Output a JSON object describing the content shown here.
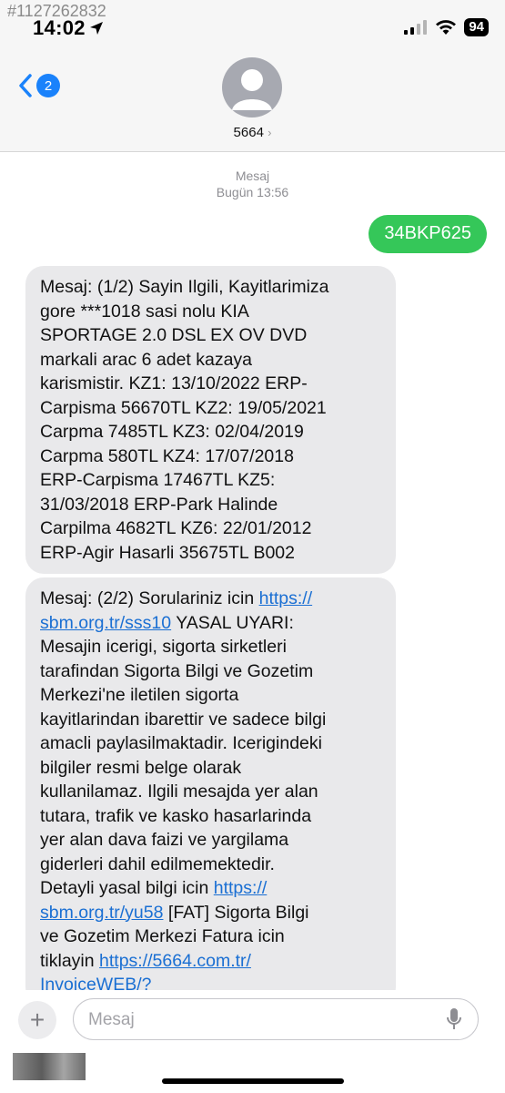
{
  "overlay_id": "#1127262832",
  "status_bar": {
    "time": "14:02",
    "battery": "94"
  },
  "header": {
    "back_badge": "2",
    "contact_name": "5664"
  },
  "thread": {
    "meta_label": "Mesaj",
    "meta_time": "Bugün 13:56",
    "outgoing": "34BKP625",
    "incoming": [
      {
        "lines": [
          "Mesaj: (1/2) Sayin Ilgili, Kayitlarimiza",
          "gore ***1018 sasi nolu KIA",
          "SPORTAGE 2.0 DSL EX OV DVD",
          "markali arac 6 adet kazaya",
          "karismistir. KZ1: 13/10/2022 ERP-",
          "Carpisma 56670TL KZ2: 19/05/2021",
          "Carpma 7485TL KZ3: 02/04/2019",
          "Carpma 580TL KZ4: 17/07/2018",
          "ERP-Carpisma 17467TL KZ5:",
          "31/03/2018 ERP-Park Halinde",
          "Carpilma 4682TL KZ6: 22/01/2012",
          "ERP-Agir Hasarli 35675TL B002"
        ]
      },
      {
        "l1_text": "Mesaj: (2/2) Sorulariniz icin ",
        "l1_link": "https://",
        "l2_link": "sbm.org.tr/sss10",
        "l2_text": " YASAL UYARI:",
        "mid_lines": [
          "Mesajin icerigi, sigorta sirketleri",
          "tarafindan Sigorta Bilgi ve Gozetim",
          "Merkezi'ne iletilen sigorta",
          "kayitlarindan ibarettir ve sadece bilgi",
          "amacli paylasilmaktadir. Icerigindeki",
          "bilgiler resmi belge olarak",
          "kullanilamaz. Ilgili mesajda yer alan",
          "tutara, trafik ve kasko hasarlarinda",
          "yer alan dava faizi ve yargilama",
          "giderleri dahil edilmemektedir."
        ],
        "l13_text": "Detayli yasal bilgi icin ",
        "l13_link": "https://",
        "l14_link": "sbm.org.tr/yu58",
        "l14_text": " [FAT] Sigorta Bilgi",
        "l15_text": "ve Gozetim Merkezi Fatura icin",
        "l16_text": "tiklayin ",
        "l16_link": "https://5664.com.tr/",
        "l17_link": "InvoiceWEB/?"
      }
    ]
  },
  "composer": {
    "placeholder": "Mesaj"
  },
  "colors": {
    "accent": "#1a82fb",
    "outgoing_bubble": "#35c759",
    "incoming_bubble": "#e9e9eb"
  }
}
